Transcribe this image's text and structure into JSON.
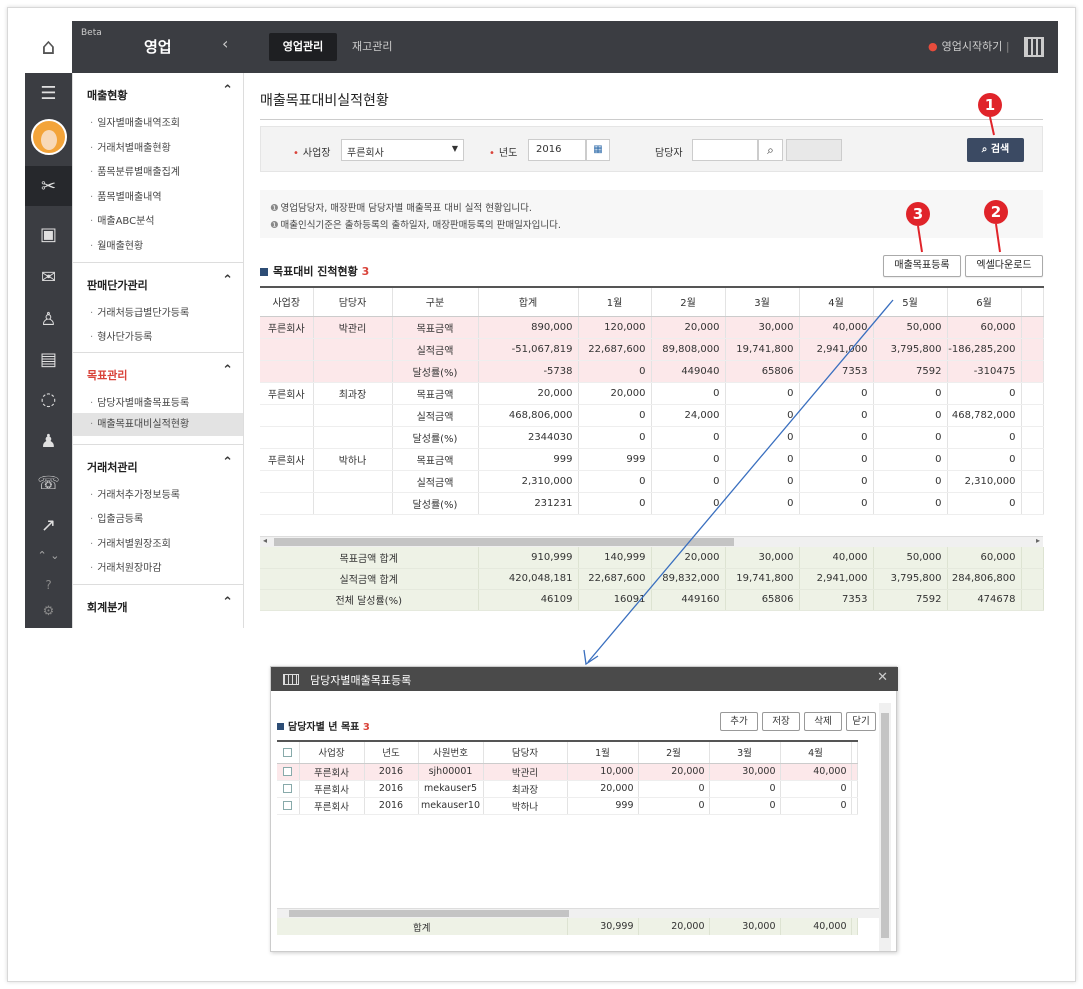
{
  "app": {
    "beta": "Beta",
    "title": "영업",
    "tabs": [
      "영업관리",
      "재고관리"
    ],
    "start_label": "영업시작하기",
    "divider": "|"
  },
  "sidebar": [
    {
      "title": "매출현황",
      "items": [
        "일자별매출내역조회",
        "거래처별매출현황",
        "품목분류별매출집계",
        "품목별매출내역",
        "매출ABC분석",
        "월매출현황"
      ]
    },
    {
      "title": "판매단가관리",
      "items": [
        "거래처등급별단가등록",
        "형사단가등록"
      ]
    },
    {
      "title": "목표관리",
      "items": [
        "담당자별매출목표등록",
        "매출목표대비실적현황"
      ]
    },
    {
      "title": "거래처관리",
      "items": [
        "거래처추가정보등록",
        "입출금등록",
        "거래처별원장조회",
        "거래처원장마감"
      ]
    },
    {
      "title": "회계분개",
      "items": []
    }
  ],
  "page": {
    "title": "매출목표대비실적현황"
  },
  "search": {
    "company_label": "사업장",
    "company_value": "푸른회사",
    "year_label": "년도",
    "year_value": "2016",
    "manager_label": "담당자",
    "manager_value": "",
    "search_button": "검색"
  },
  "notice": [
    "영업담당자, 매장판매 담당자별 매출목표 대비 실적 현황입니다.",
    "매출인식기준은 출하등록의 출하일자, 매장판매등록의 판매일자입니다."
  ],
  "grid": {
    "title": "목표대비 진척현황",
    "count": "3",
    "register_button": "매출목표등록",
    "excel_button": "엑셀다운로드",
    "headers": [
      "사업장",
      "담당자",
      "구분",
      "합계",
      "1월",
      "2월",
      "3월",
      "4월",
      "5월",
      "6월"
    ],
    "rows": [
      [
        "푸른회사",
        "박관리",
        "목표금액",
        "890,000",
        "120,000",
        "20,000",
        "30,000",
        "40,000",
        "50,000",
        "60,000"
      ],
      [
        "",
        "",
        "실적금액",
        "-51,067,819",
        "22,687,600",
        "89,808,000",
        "19,741,800",
        "2,941,000",
        "3,795,800",
        "-186,285,200"
      ],
      [
        "",
        "",
        "달성률(%)",
        "-5738",
        "0",
        "449040",
        "65806",
        "7353",
        "7592",
        "-310475"
      ],
      [
        "푸른회사",
        "최과장",
        "목표금액",
        "20,000",
        "20,000",
        "0",
        "0",
        "0",
        "0",
        "0"
      ],
      [
        "",
        "",
        "실적금액",
        "468,806,000",
        "0",
        "24,000",
        "0",
        "0",
        "0",
        "468,782,000"
      ],
      [
        "",
        "",
        "달성률(%)",
        "2344030",
        "0",
        "0",
        "0",
        "0",
        "0",
        "0"
      ],
      [
        "푸른회사",
        "박하나",
        "목표금액",
        "999",
        "999",
        "0",
        "0",
        "0",
        "0",
        "0"
      ],
      [
        "",
        "",
        "실적금액",
        "2,310,000",
        "0",
        "0",
        "0",
        "0",
        "0",
        "2,310,000"
      ],
      [
        "",
        "",
        "달성률(%)",
        "231231",
        "0",
        "0",
        "0",
        "0",
        "0",
        "0"
      ]
    ],
    "footer": [
      [
        "목표금액 합계",
        "910,999",
        "140,999",
        "20,000",
        "30,000",
        "40,000",
        "50,000",
        "60,000"
      ],
      [
        "실적금액 합계",
        "420,048,181",
        "22,687,600",
        "89,832,000",
        "19,741,800",
        "2,941,000",
        "3,795,800",
        "284,806,800"
      ],
      [
        "전체 달성률(%)",
        "46109",
        "16091",
        "449160",
        "65806",
        "7353",
        "7592",
        "474678"
      ]
    ]
  },
  "modal": {
    "title": "담당자별매출목표등록",
    "grid_title": "담당자별 년 목표",
    "count": "3",
    "buttons": [
      "추가",
      "저장",
      "삭제",
      "닫기"
    ],
    "headers": [
      "사업장",
      "년도",
      "사원번호",
      "담당자",
      "1월",
      "2월",
      "3월",
      "4월"
    ],
    "rows": [
      [
        "푸른회사",
        "2016",
        "sjh00001",
        "박관리",
        "10,000",
        "20,000",
        "30,000",
        "40,000"
      ],
      [
        "푸른회사",
        "2016",
        "mekauser5",
        "최과장",
        "20,000",
        "0",
        "0",
        "0"
      ],
      [
        "푸른회사",
        "2016",
        "mekauser10",
        "박하나",
        "999",
        "0",
        "0",
        "0"
      ]
    ],
    "footer": [
      "합계",
      "30,999",
      "20,000",
      "30,000",
      "40,000"
    ]
  },
  "badges": [
    "1",
    "2",
    "3"
  ],
  "colors": {
    "accent_red": "#e0242a",
    "dark_bar": "#3b3d42",
    "search_btn": "#3b4a63"
  }
}
